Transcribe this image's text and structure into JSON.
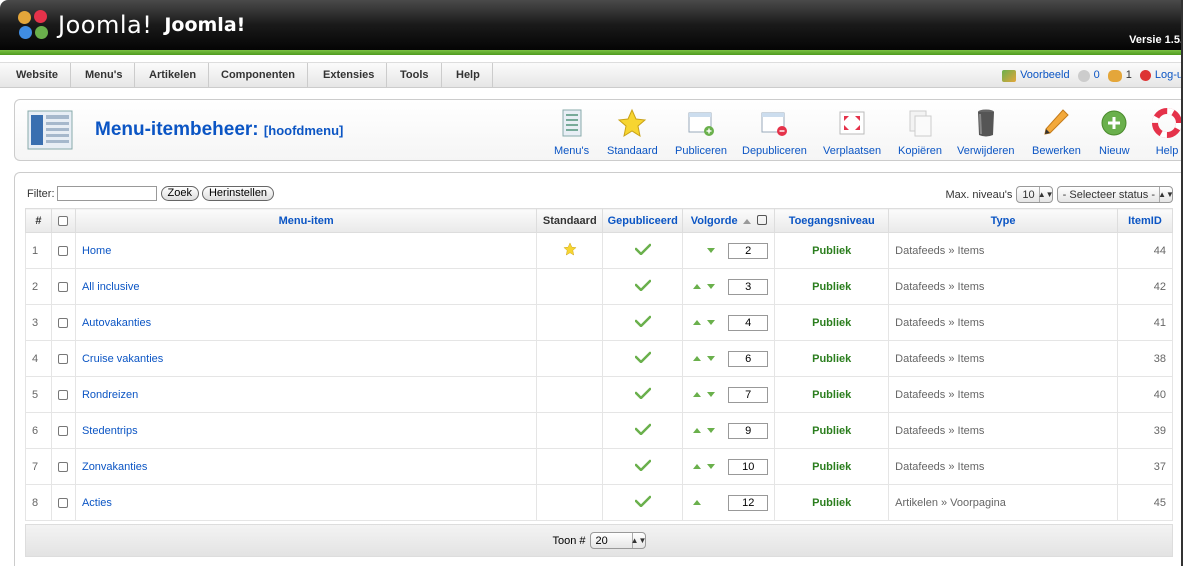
{
  "header": {
    "logo_text": "Joomla!",
    "site_name": "Joomla!",
    "version": "Versie 1.5."
  },
  "menubar": {
    "items": [
      "Website",
      "Menu's",
      "Artikelen",
      "Componenten",
      "Extensies",
      "Tools",
      "Help"
    ]
  },
  "status": {
    "preview": "Voorbeeld",
    "messages": "0",
    "users": "1",
    "logout": "Log-u"
  },
  "page": {
    "title": "Menu-itembeheer:",
    "subtitle": "[hoofdmenu]"
  },
  "toolbar": {
    "buttons": [
      "Menu's",
      "Standaard",
      "Publiceren",
      "Depubliceren",
      "Verplaatsen",
      "Kopiëren",
      "Verwijderen",
      "Bewerken",
      "Nieuw",
      "Help"
    ]
  },
  "filter": {
    "label": "Filter:",
    "value": "",
    "search_button": "Zoek",
    "reset_button": "Herinstellen",
    "max_levels_label": "Max. niveau's",
    "max_levels_value": "10",
    "status_select": "- Selecteer status -"
  },
  "table": {
    "headers": {
      "num": "#",
      "menu_item": "Menu-item",
      "default": "Standaard",
      "published": "Gepubliceerd",
      "order": "Volgorde",
      "access": "Toegangsniveau",
      "type": "Type",
      "itemid": "ItemID"
    },
    "rows": [
      {
        "num": "1",
        "name": "Home",
        "default": true,
        "order": "2",
        "access": "Publiek",
        "type": "Datafeeds » Items",
        "itemid": "44",
        "up": false,
        "down": true
      },
      {
        "num": "2",
        "name": "All inclusive",
        "default": false,
        "order": "3",
        "access": "Publiek",
        "type": "Datafeeds » Items",
        "itemid": "42",
        "up": true,
        "down": true
      },
      {
        "num": "3",
        "name": "Autovakanties",
        "default": false,
        "order": "4",
        "access": "Publiek",
        "type": "Datafeeds » Items",
        "itemid": "41",
        "up": true,
        "down": true
      },
      {
        "num": "4",
        "name": "Cruise vakanties",
        "default": false,
        "order": "6",
        "access": "Publiek",
        "type": "Datafeeds » Items",
        "itemid": "38",
        "up": true,
        "down": true
      },
      {
        "num": "5",
        "name": "Rondreizen",
        "default": false,
        "order": "7",
        "access": "Publiek",
        "type": "Datafeeds » Items",
        "itemid": "40",
        "up": true,
        "down": true
      },
      {
        "num": "6",
        "name": "Stedentrips",
        "default": false,
        "order": "9",
        "access": "Publiek",
        "type": "Datafeeds » Items",
        "itemid": "39",
        "up": true,
        "down": true
      },
      {
        "num": "7",
        "name": "Zonvakanties",
        "default": false,
        "order": "10",
        "access": "Publiek",
        "type": "Datafeeds » Items",
        "itemid": "37",
        "up": true,
        "down": true
      },
      {
        "num": "8",
        "name": "Acties",
        "default": false,
        "order": "12",
        "access": "Publiek",
        "type": "Artikelen » Voorpagina",
        "itemid": "45",
        "up": true,
        "down": false
      }
    ]
  },
  "footer": {
    "show_label": "Toon #",
    "show_value": "20"
  },
  "colors": {
    "link": "#0b55c4",
    "accent_green": "#6ab04c",
    "access_green": "#2b7e1e"
  }
}
